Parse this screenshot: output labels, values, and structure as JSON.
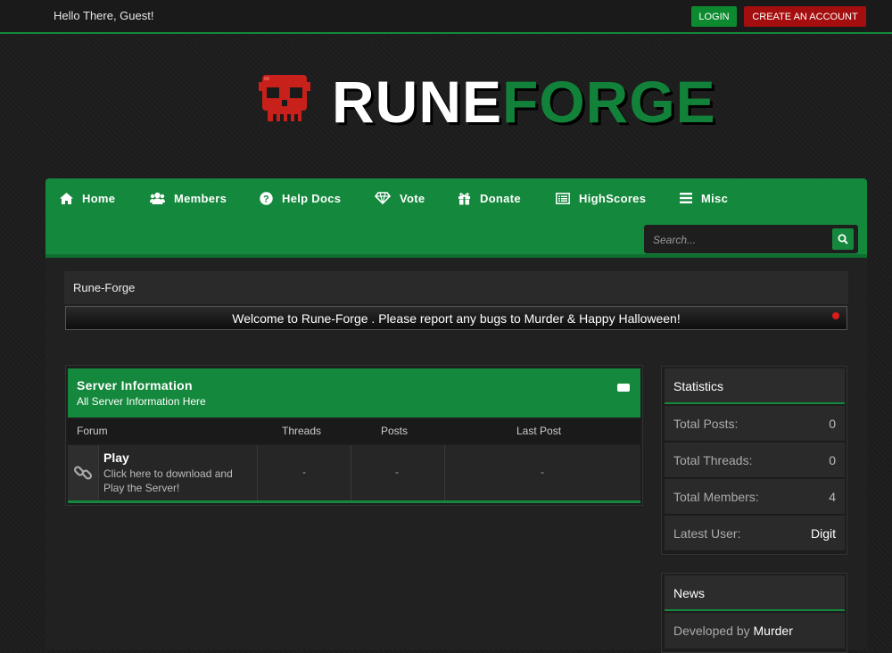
{
  "topbar": {
    "greeting": "Hello There, Guest!",
    "login_label": "LOGIN",
    "create_label": "CREATE AN ACCOUNT",
    "login_color": "#0d8a2f",
    "create_color": "#a40e0e"
  },
  "logo": {
    "part1": "RUNE",
    "part2": "FORGE",
    "icon": "skull-icon"
  },
  "nav": {
    "accent": "#14883c",
    "items": [
      {
        "label": "Home",
        "icon": "home-icon"
      },
      {
        "label": "Members",
        "icon": "users-icon"
      },
      {
        "label": "Help Docs",
        "icon": "question-circle-icon"
      },
      {
        "label": "Vote",
        "icon": "diamond-icon"
      },
      {
        "label": "Donate",
        "icon": "gift-icon"
      },
      {
        "label": "HighScores",
        "icon": "list-icon"
      },
      {
        "label": "Misc",
        "icon": "bars-icon"
      }
    ],
    "search_placeholder": "Search..."
  },
  "breadcrumb": "Rune-Forge",
  "announcement": "Welcome to Rune-Forge . Please report any bugs to Murder & Happy Halloween!",
  "forum": {
    "title": "Server Information",
    "subtitle": "All Server Information Here",
    "columns": [
      "Forum",
      "Threads",
      "Posts",
      "Last Post"
    ],
    "rows": [
      {
        "name": "Play",
        "desc": "Click here to download and Play the Server!",
        "threads": "-",
        "posts": "-",
        "last_post": "-",
        "icon": "link-icon"
      }
    ]
  },
  "statistics": {
    "title": "Statistics",
    "items": [
      {
        "label": "Total Posts:",
        "value": "0"
      },
      {
        "label": "Total Threads:",
        "value": "0"
      },
      {
        "label": "Total Members:",
        "value": "4"
      },
      {
        "label": "Latest User:",
        "value": "Digit"
      }
    ]
  },
  "news": {
    "title": "News",
    "prefix": "Developed by",
    "author": "Murder"
  }
}
